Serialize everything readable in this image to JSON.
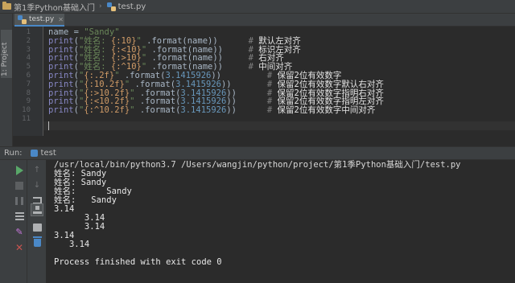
{
  "breadcrumb": {
    "project": "第1季Python基础入门",
    "file": "test.py"
  },
  "editor_tab": {
    "label": "test.py"
  },
  "sidebar": {
    "project_label": "1: Project"
  },
  "code": {
    "line_numbers": [
      "1",
      "2",
      "3",
      "4",
      "5",
      "6",
      "7",
      "8",
      "9",
      "10",
      "11"
    ],
    "lines": [
      [
        {
          "t": "name",
          "c": ""
        },
        {
          "t": " = ",
          "c": ""
        },
        {
          "t": "\"Sandy\"",
          "c": "str"
        }
      ],
      [
        {
          "t": "print",
          "c": "kw"
        },
        {
          "t": "(",
          "c": ""
        },
        {
          "t": "\"姓名: ",
          "c": "str"
        },
        {
          "t": "{:10}",
          "c": "fmt"
        },
        {
          "t": "\"",
          "c": "str"
        },
        {
          "t": " .format(name))      ",
          "c": ""
        },
        {
          "t": "# ",
          "c": "cm"
        },
        {
          "t": "默认左对齐",
          "c": "cm-cn"
        }
      ],
      [
        {
          "t": "print",
          "c": "kw"
        },
        {
          "t": "(",
          "c": ""
        },
        {
          "t": "\"姓名: ",
          "c": "str"
        },
        {
          "t": "{:<10}",
          "c": "fmt"
        },
        {
          "t": "\"",
          "c": "str"
        },
        {
          "t": " .format(name))     ",
          "c": ""
        },
        {
          "t": "# ",
          "c": "cm"
        },
        {
          "t": "标识左对齐",
          "c": "cm-cn"
        }
      ],
      [
        {
          "t": "print",
          "c": "kw"
        },
        {
          "t": "(",
          "c": ""
        },
        {
          "t": "\"姓名: ",
          "c": "str"
        },
        {
          "t": "{:>10}",
          "c": "fmt"
        },
        {
          "t": "\"",
          "c": "str"
        },
        {
          "t": " .format(name))     ",
          "c": ""
        },
        {
          "t": "# ",
          "c": "cm"
        },
        {
          "t": "右对齐",
          "c": "cm-cn"
        }
      ],
      [
        {
          "t": "print",
          "c": "kw"
        },
        {
          "t": "(",
          "c": ""
        },
        {
          "t": "\"姓名: ",
          "c": "str"
        },
        {
          "t": "{:^10}",
          "c": "fmt"
        },
        {
          "t": "\"",
          "c": "str"
        },
        {
          "t": " .format(name))     ",
          "c": ""
        },
        {
          "t": "# ",
          "c": "cm"
        },
        {
          "t": "中间对齐",
          "c": "cm-cn"
        }
      ],
      [
        {
          "t": "print",
          "c": "kw"
        },
        {
          "t": "(",
          "c": ""
        },
        {
          "t": "\"",
          "c": "str"
        },
        {
          "t": "{:.2f}",
          "c": "fmt"
        },
        {
          "t": "\"",
          "c": "str"
        },
        {
          "t": " .format(",
          "c": ""
        },
        {
          "t": "3.1415926",
          "c": "num"
        },
        {
          "t": "))         ",
          "c": ""
        },
        {
          "t": "# ",
          "c": "cm"
        },
        {
          "t": "保留2位有效数字",
          "c": "cm-cn"
        }
      ],
      [
        {
          "t": "print",
          "c": "kw"
        },
        {
          "t": "(",
          "c": ""
        },
        {
          "t": "\"",
          "c": "str"
        },
        {
          "t": "{:10.2f}",
          "c": "fmt"
        },
        {
          "t": "\"",
          "c": "str"
        },
        {
          "t": " .format(",
          "c": ""
        },
        {
          "t": "3.1415926",
          "c": "num"
        },
        {
          "t": "))       ",
          "c": ""
        },
        {
          "t": "# ",
          "c": "cm"
        },
        {
          "t": "保留2位有效数字默认右对齐",
          "c": "cm-cn"
        }
      ],
      [
        {
          "t": "print",
          "c": "kw"
        },
        {
          "t": "(",
          "c": ""
        },
        {
          "t": "\"",
          "c": "str"
        },
        {
          "t": "{:>10.2f}",
          "c": "fmt"
        },
        {
          "t": "\"",
          "c": "str"
        },
        {
          "t": " .format(",
          "c": ""
        },
        {
          "t": "3.1415926",
          "c": "num"
        },
        {
          "t": "))      ",
          "c": ""
        },
        {
          "t": "# ",
          "c": "cm"
        },
        {
          "t": "保留2位有效数字指明右对齐",
          "c": "cm-cn"
        }
      ],
      [
        {
          "t": "print",
          "c": "kw"
        },
        {
          "t": "(",
          "c": ""
        },
        {
          "t": "\"",
          "c": "str"
        },
        {
          "t": "{:<10.2f}",
          "c": "fmt"
        },
        {
          "t": "\"",
          "c": "str"
        },
        {
          "t": " .format(",
          "c": ""
        },
        {
          "t": "3.1415926",
          "c": "num"
        },
        {
          "t": "))      ",
          "c": ""
        },
        {
          "t": "# ",
          "c": "cm"
        },
        {
          "t": "保留2位有效数字指明左对齐",
          "c": "cm-cn"
        }
      ],
      [
        {
          "t": "print",
          "c": "kw"
        },
        {
          "t": "(",
          "c": ""
        },
        {
          "t": "\"",
          "c": "str"
        },
        {
          "t": "{:^10.2f}",
          "c": "fmt"
        },
        {
          "t": "\"",
          "c": "str"
        },
        {
          "t": " .format(",
          "c": ""
        },
        {
          "t": "3.1415926",
          "c": "num"
        },
        {
          "t": "))      ",
          "c": ""
        },
        {
          "t": "# ",
          "c": "cm"
        },
        {
          "t": "保留2位有效数字中间对齐",
          "c": "cm-cn"
        }
      ],
      []
    ]
  },
  "run_panel": {
    "title": "Run:",
    "tab_label": "test"
  },
  "console": {
    "lines": [
      "/usr/local/bin/python3.7 /Users/wangjin/python/project/第1季Python基础入门/test.py",
      "姓名: Sandy",
      "姓名: Sandy",
      "姓名:      Sandy",
      "姓名:   Sandy",
      "3.14",
      "      3.14",
      "      3.14",
      "3.14",
      "   3.14",
      "",
      "Process finished with exit code 0"
    ]
  },
  "colors": {
    "editor_bg": "#2b2b2b",
    "panel_bg": "#3c3f41",
    "keyword": "#8888c6",
    "string": "#6a8759",
    "format_spec": "#d19c67",
    "number": "#6897bb",
    "comment": "#808080",
    "run_green": "#59a869"
  },
  "icons": [
    "folder-icon",
    "python-file-icon",
    "play-icon",
    "stop-icon",
    "pause-icon",
    "rerun-icon",
    "print-icon",
    "pin-icon",
    "close-icon",
    "arrow-up-icon",
    "arrow-down-icon",
    "soft-wrap-icon",
    "scroll-end-icon",
    "trash-icon"
  ]
}
